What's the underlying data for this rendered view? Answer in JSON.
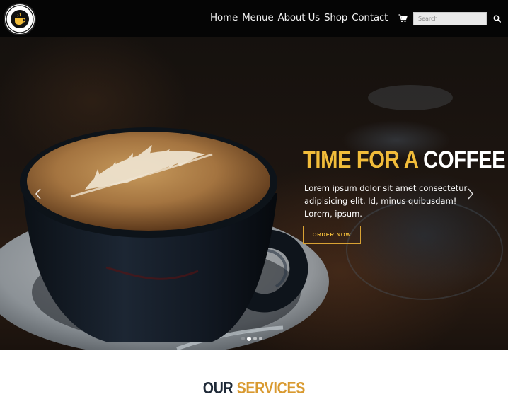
{
  "brand": {
    "logo_text_top": "CAFEINATED COFFEE",
    "logo_text_bottom": "SINCE 1978",
    "logo_icon": "coffee-cup-logo"
  },
  "nav": {
    "items": [
      {
        "label": "Home"
      },
      {
        "label": "Menue"
      },
      {
        "label": "About Us"
      },
      {
        "label": "Shop"
      },
      {
        "label": "Contact"
      }
    ],
    "cart_icon": "cart-icon",
    "search_placeholder": "Search",
    "search_value": "",
    "search_icon": "search-icon"
  },
  "hero": {
    "title_part1": "TIME FOR A",
    "title_part2": "COFFEE",
    "text": "Lorem ipsum dolor sit amet consectetur adipisicing elit. Id, minus quibusdam! Lorem, ipsum.",
    "button_label": "ORDER NOW",
    "prev_icon": "chevron-left-icon",
    "next_icon": "chevron-right-icon",
    "slides_count": 4,
    "active_slide": 2
  },
  "services": {
    "title_part1": "OUR",
    "title_part2": "SERVICES"
  },
  "colors": {
    "accent": "#f1bc3a",
    "navbar_bg": "#050505",
    "heading_dark": "#1f2a38"
  }
}
